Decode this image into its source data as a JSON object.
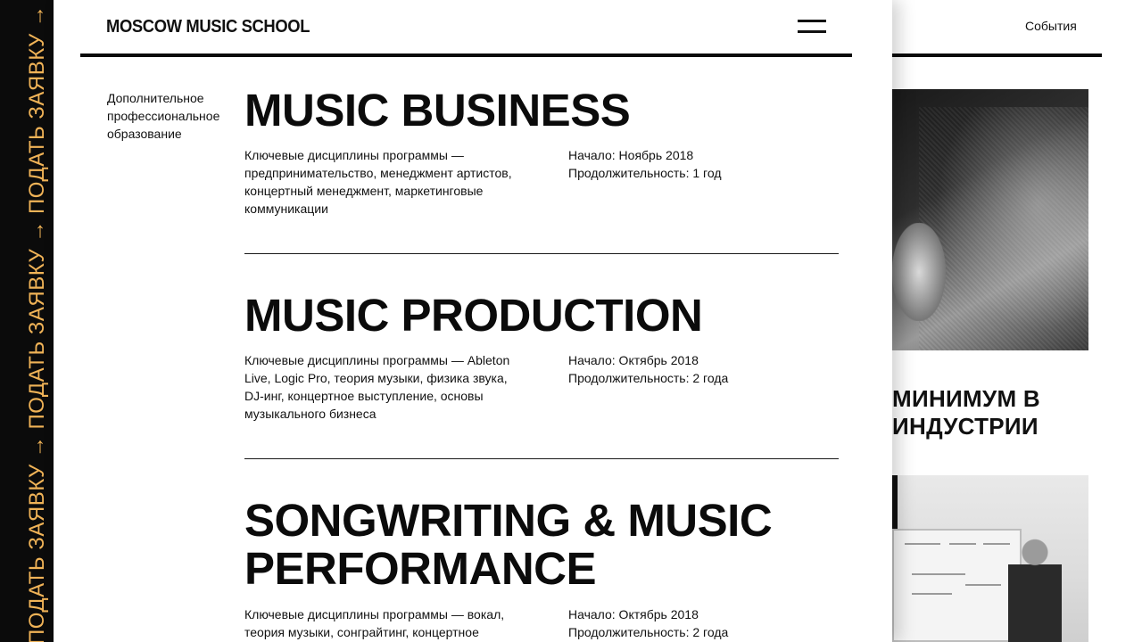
{
  "strip": {
    "text": "ПОДАТЬ ЗАЯВКУ → ПОДАТЬ ЗАЯВКУ → ПОДАТЬ ЗАЯВКУ → ПОДАТЬ ЗАЯВКУ",
    "color": "#f0b357",
    "background": "#0b0b0b"
  },
  "header": {
    "logo": "MOSCOW MUSIC SCHOOL",
    "menu_icon": "hamburger-icon"
  },
  "background_page": {
    "nav_events": "События",
    "heading": "МИНИМУМ В ИНДУСТРИИ"
  },
  "menu": {
    "category": "Дополнительное профессиональное образование",
    "programs": [
      {
        "title": "MUSIC BUSINESS",
        "description": "Ключевые дисциплины программы — предпринимательство, менеджмент артистов, концертный менеджмент, маркетинговые коммуникации",
        "start": "Начало: Ноябрь 2018",
        "duration": "Продолжительность: 1 год"
      },
      {
        "title": "MUSIC PRODUCTION",
        "description": "Ключевые дисциплины программы — Ableton Live, Logic Pro, теория музыки, физика звука, DJ-инг, концертное выступление, основы музыкального бизнеса",
        "start": "Начало: Октябрь 2018",
        "duration": "Продолжительность: 2 года"
      },
      {
        "title": "SONGWRITING & MUSIC PERFORMANCE",
        "description": "Ключевые дисциплины программы — вокал, теория музыки, сонграйтинг, концертное",
        "start": "Начало: Октябрь 2018",
        "duration": "Продолжительность: 2 года"
      }
    ]
  }
}
